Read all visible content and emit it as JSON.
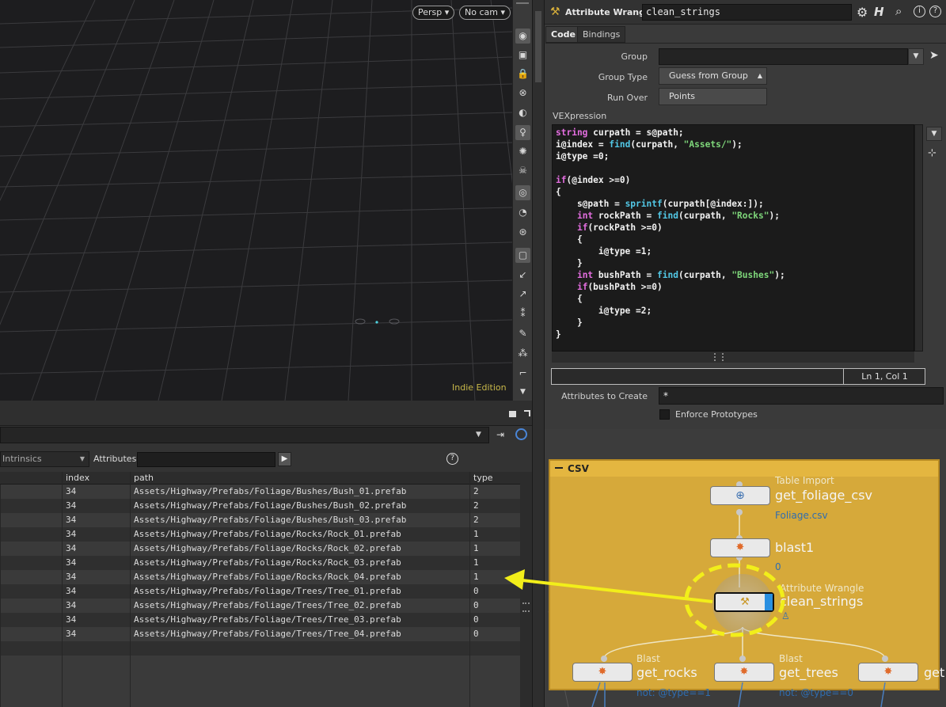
{
  "viewport": {
    "persp_label": "Persp",
    "cam_label": "No cam",
    "edition_label": "Indie Edition"
  },
  "param": {
    "node_type": "Attribute Wrangle",
    "node_name": "clean_strings",
    "tabs": [
      "Code",
      "Bindings"
    ],
    "group_label": "Group",
    "group_value": "",
    "group_type_label": "Group Type",
    "group_type_value": "Guess from Group",
    "run_over_label": "Run Over",
    "run_over_value": "Points",
    "vex_label": "VEXpression",
    "status": "Ln 1, Col 1",
    "attrs_label": "Attributes to Create",
    "attrs_value": "*",
    "enforce_label": "Enforce Prototypes"
  },
  "sheet": {
    "filter_label": "Intrinsics",
    "attributes_label": "Attributes:",
    "columns": [
      "index",
      "path",
      "type"
    ],
    "rows": [
      [
        "34",
        "Assets/Highway/Prefabs/Foliage/Bushes/Bush_01.prefab",
        "2"
      ],
      [
        "34",
        "Assets/Highway/Prefabs/Foliage/Bushes/Bush_02.prefab",
        "2"
      ],
      [
        "34",
        "Assets/Highway/Prefabs/Foliage/Bushes/Bush_03.prefab",
        "2"
      ],
      [
        "34",
        "Assets/Highway/Prefabs/Foliage/Rocks/Rock_01.prefab",
        "1"
      ],
      [
        "34",
        "Assets/Highway/Prefabs/Foliage/Rocks/Rock_02.prefab",
        "1"
      ],
      [
        "34",
        "Assets/Highway/Prefabs/Foliage/Rocks/Rock_03.prefab",
        "1"
      ],
      [
        "34",
        "Assets/Highway/Prefabs/Foliage/Rocks/Rock_04.prefab",
        "1"
      ],
      [
        "34",
        "Assets/Highway/Prefabs/Foliage/Trees/Tree_01.prefab",
        "0"
      ],
      [
        "34",
        "Assets/Highway/Prefabs/Foliage/Trees/Tree_02.prefab",
        "0"
      ],
      [
        "34",
        "Assets/Highway/Prefabs/Foliage/Trees/Tree_03.prefab",
        "0"
      ],
      [
        "34",
        "Assets/Highway/Prefabs/Foliage/Trees/Tree_04.prefab",
        "0"
      ]
    ]
  },
  "network": {
    "box_title": "CSV",
    "nodes": {
      "table_import": {
        "type": "Table Import",
        "name": "get_foliage_csv",
        "sub": "Foliage.csv"
      },
      "blast1": {
        "name": "blast1",
        "sub": "0"
      },
      "wrangle": {
        "type": "Attribute Wrangle",
        "name": "clean_strings"
      },
      "get_rocks": {
        "type": "Blast",
        "name": "get_rocks",
        "sub": "not: @type==1"
      },
      "get_trees": {
        "type": "Blast",
        "name": "get_trees",
        "sub": "not: @type==0"
      },
      "get_bushes": {
        "type": "Blast",
        "name": "get"
      }
    }
  },
  "colors": {
    "network_box": "#d6a93a",
    "highlight": "#f2ee1a",
    "keyword": "#e46ee0",
    "function": "#52c8e6",
    "string": "#7ed67a"
  }
}
